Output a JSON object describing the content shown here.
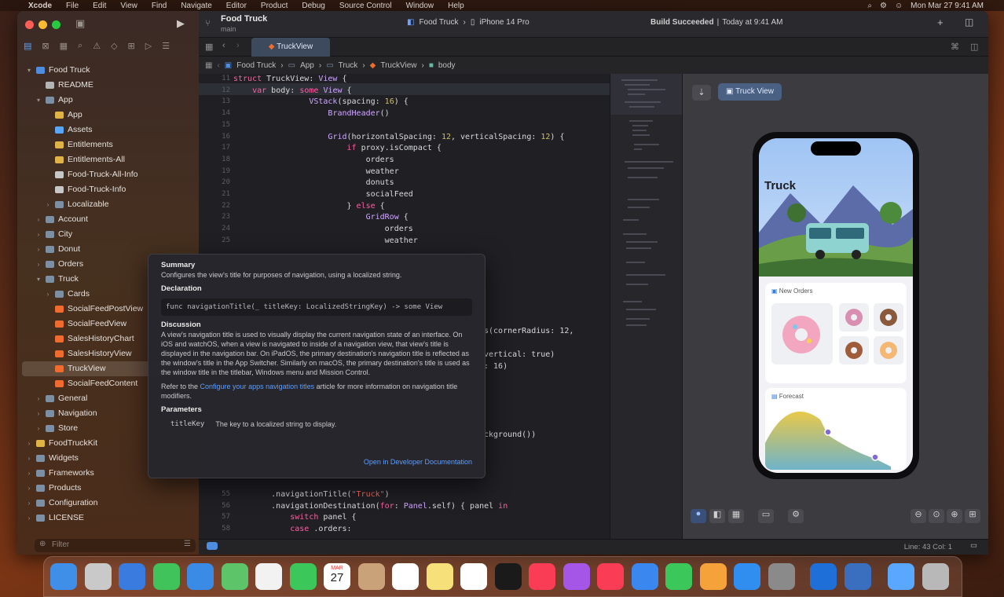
{
  "menubar": {
    "app": "Xcode",
    "items": [
      "File",
      "Edit",
      "View",
      "Find",
      "Navigate",
      "Editor",
      "Product",
      "Debug",
      "Source Control",
      "Window",
      "Help"
    ],
    "clock": "Mon Mar 27  9:41 AM"
  },
  "project": {
    "name": "Food Truck",
    "branch": "main",
    "scheme": "Food Truck",
    "destination": "iPhone 14 Pro",
    "status": "Build Succeeded",
    "status_time": "Today at 9:41 AM"
  },
  "tab": {
    "label": "TruckView"
  },
  "jumpbar": [
    "Food Truck",
    "App",
    "Truck",
    "TruckView",
    "body"
  ],
  "navigator": [
    {
      "label": "Food Truck",
      "depth": 0,
      "chev": "down",
      "icon": "proj"
    },
    {
      "label": "README",
      "depth": 1,
      "chev": "",
      "icon": "file"
    },
    {
      "label": "App",
      "depth": 1,
      "chev": "down",
      "icon": "folder"
    },
    {
      "label": "App",
      "depth": 2,
      "chev": "",
      "icon": "yellow"
    },
    {
      "label": "Assets",
      "depth": 2,
      "chev": "",
      "icon": "asset"
    },
    {
      "label": "Entitlements",
      "depth": 2,
      "chev": "",
      "icon": "yellow"
    },
    {
      "label": "Entitlements-All",
      "depth": 2,
      "chev": "",
      "icon": "yellow"
    },
    {
      "label": "Food-Truck-All-Info",
      "depth": 2,
      "chev": "",
      "icon": "plist"
    },
    {
      "label": "Food-Truck-Info",
      "depth": 2,
      "chev": "",
      "icon": "plist"
    },
    {
      "label": "Localizable",
      "depth": 2,
      "chev": "right",
      "icon": "folder"
    },
    {
      "label": "Account",
      "depth": 1,
      "chev": "right",
      "icon": "folder"
    },
    {
      "label": "City",
      "depth": 1,
      "chev": "right",
      "icon": "folder"
    },
    {
      "label": "Donut",
      "depth": 1,
      "chev": "right",
      "icon": "folder"
    },
    {
      "label": "Orders",
      "depth": 1,
      "chev": "right",
      "icon": "folder"
    },
    {
      "label": "Truck",
      "depth": 1,
      "chev": "down",
      "icon": "folder"
    },
    {
      "label": "Cards",
      "depth": 2,
      "chev": "right",
      "icon": "folder"
    },
    {
      "label": "SocialFeedPostView",
      "depth": 2,
      "chev": "",
      "icon": "swift"
    },
    {
      "label": "SocialFeedView",
      "depth": 2,
      "chev": "",
      "icon": "swift"
    },
    {
      "label": "SalesHistoryChart",
      "depth": 2,
      "chev": "",
      "icon": "swift"
    },
    {
      "label": "SalesHistoryView",
      "depth": 2,
      "chev": "",
      "icon": "swift"
    },
    {
      "label": "TruckView",
      "depth": 2,
      "chev": "",
      "icon": "swift",
      "selected": true
    },
    {
      "label": "SocialFeedContent",
      "depth": 2,
      "chev": "",
      "icon": "swift"
    },
    {
      "label": "General",
      "depth": 1,
      "chev": "right",
      "icon": "folder"
    },
    {
      "label": "Navigation",
      "depth": 1,
      "chev": "right",
      "icon": "folder"
    },
    {
      "label": "Store",
      "depth": 1,
      "chev": "right",
      "icon": "folder"
    },
    {
      "label": "FoodTruckKit",
      "depth": 0,
      "chev": "right",
      "icon": "yellow"
    },
    {
      "label": "Widgets",
      "depth": 0,
      "chev": "right",
      "icon": "folder"
    },
    {
      "label": "Frameworks",
      "depth": 0,
      "chev": "right",
      "icon": "folder"
    },
    {
      "label": "Products",
      "depth": 0,
      "chev": "right",
      "icon": "folder"
    },
    {
      "label": "Configuration",
      "depth": 0,
      "chev": "right",
      "icon": "folder"
    },
    {
      "label": "LICENSE",
      "depth": 0,
      "chev": "right",
      "icon": "folder"
    }
  ],
  "filter_placeholder": "Filter",
  "code": [
    {
      "n": "11",
      "t": "struct TruckView: View {"
    },
    {
      "n": "12",
      "t": "    var body: some View {"
    },
    {
      "n": "13",
      "t": "                VStack(spacing: 16) {"
    },
    {
      "n": "14",
      "t": "                    BrandHeader()"
    },
    {
      "n": "15",
      "t": ""
    },
    {
      "n": "16",
      "t": "                    Grid(horizontalSpacing: 12, verticalSpacing: 12) {"
    },
    {
      "n": "17",
      "t": "                        if proxy.isCompact {"
    },
    {
      "n": "18",
      "t": "                            orders"
    },
    {
      "n": "19",
      "t": "                            weather"
    },
    {
      "n": "20",
      "t": "                            donuts"
    },
    {
      "n": "21",
      "t": "                            socialFeed"
    },
    {
      "n": "22",
      "t": "                        } else {"
    },
    {
      "n": "23",
      "t": "                            GridRow {"
    },
    {
      "n": "24",
      "t": "                                orders"
    },
    {
      "n": "25",
      "t": "                                weather"
    }
  ],
  "code_fragments": [
    "s(cornerRadius: 12,",
    "vertical: true)",
    ": 16)",
    "ckground())"
  ],
  "code_bottom": [
    {
      "n": "55",
      "t": "        .navigationTitle(\"Truck\")"
    },
    {
      "n": "56",
      "t": "        .navigationDestination(for: Panel.self) { panel in"
    },
    {
      "n": "57",
      "t": "            switch panel {"
    },
    {
      "n": "58",
      "t": "            case .orders:"
    }
  ],
  "doc": {
    "summary_h": "Summary",
    "summary": "Configures the view's title for purposes of navigation, using a localized string.",
    "decl_h": "Declaration",
    "decl": "func navigationTitle(_ titleKey: LocalizedStringKey) -> some View",
    "disc_h": "Discussion",
    "disc": "A view's navigation title is used to visually display the current navigation state of an interface. On iOS and watchOS, when a view is navigated to inside of a navigation view, that view's title is displayed in the navigation bar. On iPadOS, the primary destination's navigation title is reflected as the window's title in the App Switcher. Similarly on macOS, the primary destination's title is used as the window title in the titlebar, Windows menu and Mission Control.",
    "refer_pre": "Refer to the ",
    "refer_link": "Configure your apps navigation titles",
    "refer_post": " article for more information on navigation title modifiers.",
    "params_h": "Parameters",
    "param_name": "titleKey",
    "param_desc": "The key to a localized string to display.",
    "open_link": "Open in Developer Documentation"
  },
  "preview": {
    "tab_label": "Truck View",
    "title": "Truck",
    "card1_title": "New Orders",
    "card2_title": "Forecast"
  },
  "status": {
    "cursor": "Line: 43  Col: 1"
  },
  "dock": [
    "finder-icon",
    "launchpad-icon",
    "safari-icon",
    "messages-icon",
    "mail-icon",
    "maps-icon",
    "photos-icon",
    "facetime-icon",
    "calendar-icon",
    "contacts-icon",
    "reminders-icon",
    "notes-icon",
    "freeform-icon",
    "tv-icon",
    "music-icon",
    "podcasts-icon",
    "news-icon",
    "keynote-icon",
    "numbers-icon",
    "pages-icon",
    "appstore-icon",
    "settings-icon",
    "xcode-icon",
    "instruments-icon",
    "folder-icon",
    "trash-icon"
  ],
  "calendar": {
    "month": "MAR",
    "day": "27"
  },
  "colors": {
    "accent": "#4f8de0",
    "tab": "#3d4a5e",
    "swift": "#f06b2e"
  }
}
